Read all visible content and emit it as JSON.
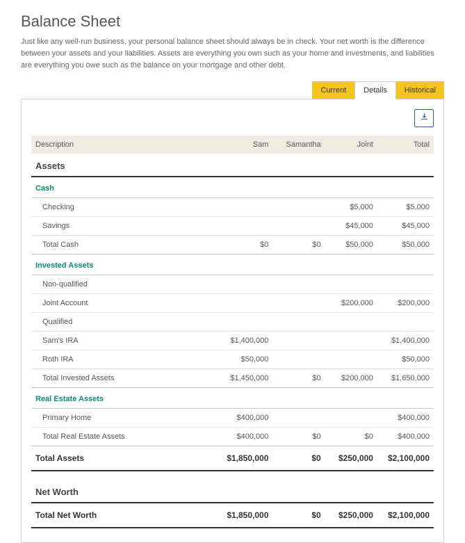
{
  "header": {
    "title": "Balance Sheet",
    "description": "Just like any well-run business, your personal balance sheet should always be in check. Your net worth is the difference between your assets and your liabilities. Assets are everything you own such as your home and investments, and liabilities are everything you owe such as the balance on your mortgage and other debt."
  },
  "tabs": {
    "current": "Current",
    "details": "Details",
    "historical": "Historical"
  },
  "columns": {
    "description": "Description",
    "c1": "Sam",
    "c2": "Samantha",
    "c3": "Joint",
    "c4": "Total"
  },
  "assets": {
    "heading": "Assets",
    "cash": {
      "label": "Cash",
      "rows": [
        {
          "label": "Checking",
          "c1": "",
          "c2": "",
          "c3": "$5,000",
          "c4": "$5,000"
        },
        {
          "label": "Savings",
          "c1": "",
          "c2": "",
          "c3": "$45,000",
          "c4": "$45,000"
        }
      ],
      "total": {
        "label": "Total Cash",
        "c1": "$0",
        "c2": "$0",
        "c3": "$50,000",
        "c4": "$50,000"
      }
    },
    "invested": {
      "label": "Invested Assets",
      "sub1": "Non-qualified",
      "rows1": [
        {
          "label": "Joint Account",
          "c1": "",
          "c2": "",
          "c3": "$200,000",
          "c4": "$200,000"
        }
      ],
      "sub2": "Qualified",
      "rows2": [
        {
          "label": "Sam's IRA",
          "c1": "$1,400,000",
          "c2": "",
          "c3": "",
          "c4": "$1,400,000"
        },
        {
          "label": "Roth IRA",
          "c1": "$50,000",
          "c2": "",
          "c3": "",
          "c4": "$50,000"
        }
      ],
      "total": {
        "label": "Total Invested Assets",
        "c1": "$1,450,000",
        "c2": "$0",
        "c3": "$200,000",
        "c4": "$1,650,000"
      }
    },
    "realestate": {
      "label": "Real Estate Assets",
      "rows": [
        {
          "label": "Primary Home",
          "c1": "$400,000",
          "c2": "",
          "c3": "",
          "c4": "$400,000"
        }
      ],
      "total": {
        "label": "Total Real Estate Assets",
        "c1": "$400,000",
        "c2": "$0",
        "c3": "$0",
        "c4": "$400,000"
      }
    },
    "total": {
      "label": "Total Assets",
      "c1": "$1,850,000",
      "c2": "$0",
      "c3": "$250,000",
      "c4": "$2,100,000"
    }
  },
  "networth": {
    "heading": "Net Worth",
    "total": {
      "label": "Total Net Worth",
      "c1": "$1,850,000",
      "c2": "$0",
      "c3": "$250,000",
      "c4": "$2,100,000"
    }
  },
  "chart_data": {
    "type": "table",
    "columns": [
      "Description",
      "Sam",
      "Samantha",
      "Joint",
      "Total"
    ],
    "rows": [
      [
        "Checking",
        null,
        null,
        5000,
        5000
      ],
      [
        "Savings",
        null,
        null,
        45000,
        45000
      ],
      [
        "Total Cash",
        0,
        0,
        50000,
        50000
      ],
      [
        "Joint Account",
        null,
        null,
        200000,
        200000
      ],
      [
        "Sam's IRA",
        1400000,
        null,
        null,
        1400000
      ],
      [
        "Roth IRA",
        50000,
        null,
        null,
        50000
      ],
      [
        "Total Invested Assets",
        1450000,
        0,
        200000,
        1650000
      ],
      [
        "Primary Home",
        400000,
        null,
        null,
        400000
      ],
      [
        "Total Real Estate Assets",
        400000,
        0,
        0,
        400000
      ],
      [
        "Total Assets",
        1850000,
        0,
        250000,
        2100000
      ],
      [
        "Total Net Worth",
        1850000,
        0,
        250000,
        2100000
      ]
    ]
  }
}
